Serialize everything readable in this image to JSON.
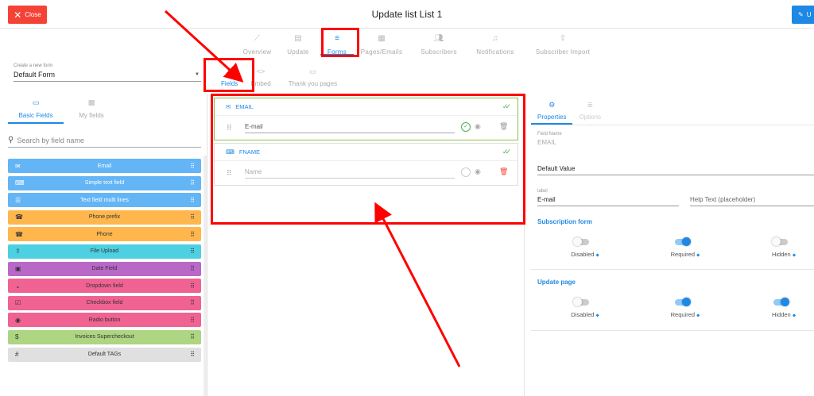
{
  "header": {
    "close_label": "Close",
    "title": "Update list List 1",
    "update_label": "U"
  },
  "main_tabs": [
    {
      "label": "Overview",
      "icon": "chart-line-icon"
    },
    {
      "label": "Update",
      "icon": "document-icon"
    },
    {
      "label": "Forms",
      "icon": "form-fields-icon",
      "active": true
    },
    {
      "label": "Pages/Emails",
      "icon": "pages-icon"
    },
    {
      "label": "Subscribers",
      "icon": "people-icon"
    },
    {
      "label": "Notifications",
      "icon": "bell-icon"
    },
    {
      "label": "Subscriber Import",
      "icon": "upload-icon"
    }
  ],
  "form_select": {
    "label": "Create a new form",
    "value": "Default Form"
  },
  "sub_tabs": [
    {
      "label": "Fields",
      "active": true
    },
    {
      "label": "Embed"
    },
    {
      "label": "Thank you pages"
    }
  ],
  "left_tabs": [
    {
      "label": "Basic Fields",
      "active": true
    },
    {
      "label": "My fields"
    }
  ],
  "search": {
    "placeholder": "Search by field name"
  },
  "field_types": [
    {
      "label": "Email",
      "color": "#64b5f6"
    },
    {
      "label": "Simple text field",
      "color": "#64b5f6"
    },
    {
      "label": "Text field multi lines",
      "color": "#64b5f6"
    },
    {
      "label": "Phone prefix",
      "color": "#ffb74d"
    },
    {
      "label": "Phone",
      "color": "#ffb74d"
    },
    {
      "label": "File Upload",
      "color": "#4dd0e1"
    },
    {
      "label": "Date Field",
      "color": "#ba68c8"
    },
    {
      "label": "Dropdown field",
      "color": "#f06292"
    },
    {
      "label": "Checkbox field",
      "color": "#f06292"
    },
    {
      "label": "Radio button",
      "color": "#f06292"
    },
    {
      "label": "Invoices Supercheckout",
      "color": "#aed581"
    },
    {
      "label": "Default TAGs",
      "color": "#e0e0e0"
    }
  ],
  "form_fields": [
    {
      "name": "EMAIL",
      "placeholder": "E-mail"
    },
    {
      "name": "FNAME",
      "placeholder": "Name"
    }
  ],
  "right_tabs": [
    {
      "label": "Properties",
      "active": true
    },
    {
      "label": "Options"
    }
  ],
  "properties": {
    "field_name_label": "Field Name",
    "field_name_value": "EMAIL",
    "default_value_label": "Default Value",
    "label_label": "label",
    "label_value": "E-mail",
    "help_text_label": "Help Text (placeholder)"
  },
  "subscription_form": {
    "title": "Subscription form",
    "toggles": [
      {
        "label": "Disabled",
        "on": false
      },
      {
        "label": "Required",
        "on": true
      },
      {
        "label": "Hidden",
        "on": false
      }
    ]
  },
  "update_page": {
    "title": "Update page",
    "toggles": [
      {
        "label": "Disabled",
        "on": false
      },
      {
        "label": "Required",
        "on": true
      },
      {
        "label": "Hidden",
        "on": true
      }
    ]
  }
}
